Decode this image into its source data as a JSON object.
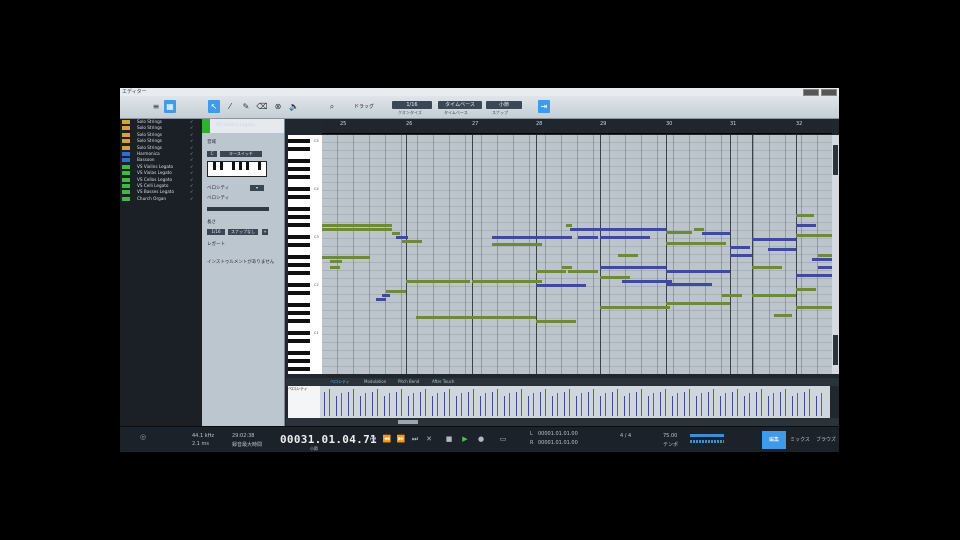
{
  "window": {
    "title": "エディター"
  },
  "toolbar": {
    "display_label": "ドラッグ",
    "quantize_value": "1/16",
    "quantize_label": "クオンタイズ",
    "timebase_value": "タイムベース",
    "timebase_label": "タイムベース",
    "snap_value": "小節",
    "snap_label": "スナップ"
  },
  "tracks": [
    {
      "name": "Solo Strings",
      "color": "#d9a13a"
    },
    {
      "name": "Solo Strings",
      "color": "#d9a13a"
    },
    {
      "name": "Solo Strings",
      "color": "#d9a13a"
    },
    {
      "name": "Solo Strings",
      "color": "#d9a13a"
    },
    {
      "name": "Solo Strings",
      "color": "#d9a13a"
    },
    {
      "name": "Harmonica",
      "color": "#2f6fd0"
    },
    {
      "name": "Bassoon",
      "color": "#2f6fd0"
    },
    {
      "name": "VS Violins Legato",
      "color": "#3cbb3c"
    },
    {
      "name": "VS Violas Legato",
      "color": "#3cbb3c"
    },
    {
      "name": "VS Cellos Legato",
      "color": "#3cbb3c"
    },
    {
      "name": "VS Celli Legato",
      "color": "#3cbb3c"
    },
    {
      "name": "VS Basses Legato",
      "color": "#3cbb3c"
    },
    {
      "name": "Church Organ",
      "color": "#3cbb3c"
    }
  ],
  "inspector": {
    "instrument": "VS Violins Legato",
    "section_label": "音域",
    "keyswitch_value": "キースイッチ",
    "velocity_label": "ベロシティ",
    "velocity_sub": "ベロシティ",
    "range_label": "長さ",
    "range_btn_a": "1/16",
    "range_btn_b": "スナップなし",
    "legato_label": "レガート",
    "notice": "インストゥルメントがありません"
  },
  "ruler": {
    "bars": [
      "25",
      "26",
      "27",
      "28",
      "29",
      "30",
      "31",
      "32"
    ]
  },
  "keys": {
    "labels": [
      "C5",
      "C4",
      "C3",
      "C2",
      "C1"
    ]
  },
  "lanes": {
    "tabs": [
      "ベロシティ",
      "Modulation",
      "Pitch Bend",
      "After Touch"
    ],
    "lane_label": "ベロシティ"
  },
  "transport": {
    "sample_rate": "44.1 kHz",
    "latency": "2.1 ms",
    "time_display": "29:02:38",
    "record_max": "録音最大時間",
    "position": "00031.01.04.71",
    "position_label": "小節",
    "loop_start": "00001.01.01.00",
    "loop_end": "00001.01.01.00",
    "loop_start_label": "L",
    "loop_end_label": "R",
    "signature": "4 / 4",
    "tempo": "75.00",
    "tempo_label": "テンポ",
    "modes": [
      "編集",
      "ミックス",
      "ブラウズ"
    ]
  },
  "colors": {
    "accent": "#3f9be8",
    "note_blue": "#3f4a9e",
    "note_green": "#6d8a3a"
  }
}
